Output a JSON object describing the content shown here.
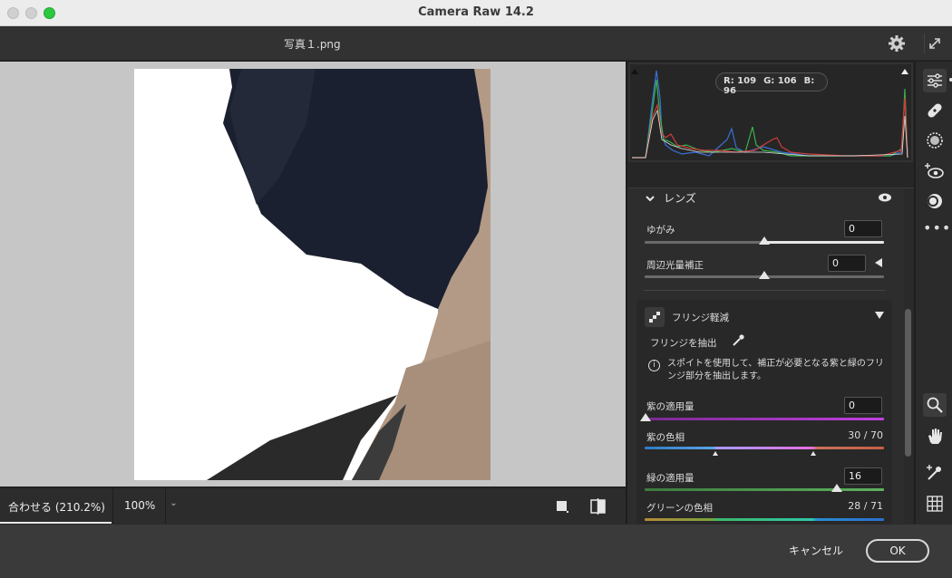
{
  "window": {
    "title": "Camera Raw 14.2"
  },
  "header": {
    "filename": "写真１.png"
  },
  "view": {
    "fit_label": "合わせる (210.2%)",
    "zoom_label": "100%",
    "zoom_dropdown": "⌄"
  },
  "histogram": {
    "readout": {
      "r": "R: 109",
      "g": "G: 106",
      "b": "B: 96"
    }
  },
  "lens": {
    "title": "レンズ",
    "distortion": {
      "label": "ゆがみ",
      "value": "0"
    },
    "vignette": {
      "label": "周辺光量補正",
      "value": "0"
    }
  },
  "defringe": {
    "title": "フリンジ軽減",
    "sample_label": "フリンジを抽出",
    "info": "スポイトを使用して、補正が必要となる紫と緑のフリンジ部分を抽出します。",
    "purple_amount": {
      "label": "紫の適用量",
      "value": "0"
    },
    "purple_hue": {
      "label": "紫の色相",
      "value": "30 / 70"
    },
    "green_amount": {
      "label": "緑の適用量",
      "value": "16"
    },
    "green_hue": {
      "label": "グリーンの色相",
      "value": "28 / 71"
    }
  },
  "footer": {
    "cancel": "キャンセル",
    "ok": "OK"
  },
  "colors": {
    "accent": "#e6e6e6",
    "panel": "#2d2d2d",
    "purple": "#b83ad6",
    "green": "#4caf50"
  },
  "icons": [
    "settings-gear-icon",
    "fullscreen-icon",
    "edit-sliders-icon",
    "healing-icon",
    "mask-icon",
    "redeye-icon",
    "presets-icon",
    "more-icon",
    "zoom-icon",
    "hand-icon",
    "color-sampler-icon",
    "grid-icon",
    "eye-icon",
    "eyedropper-icon",
    "info-icon",
    "chevron-down-icon"
  ]
}
